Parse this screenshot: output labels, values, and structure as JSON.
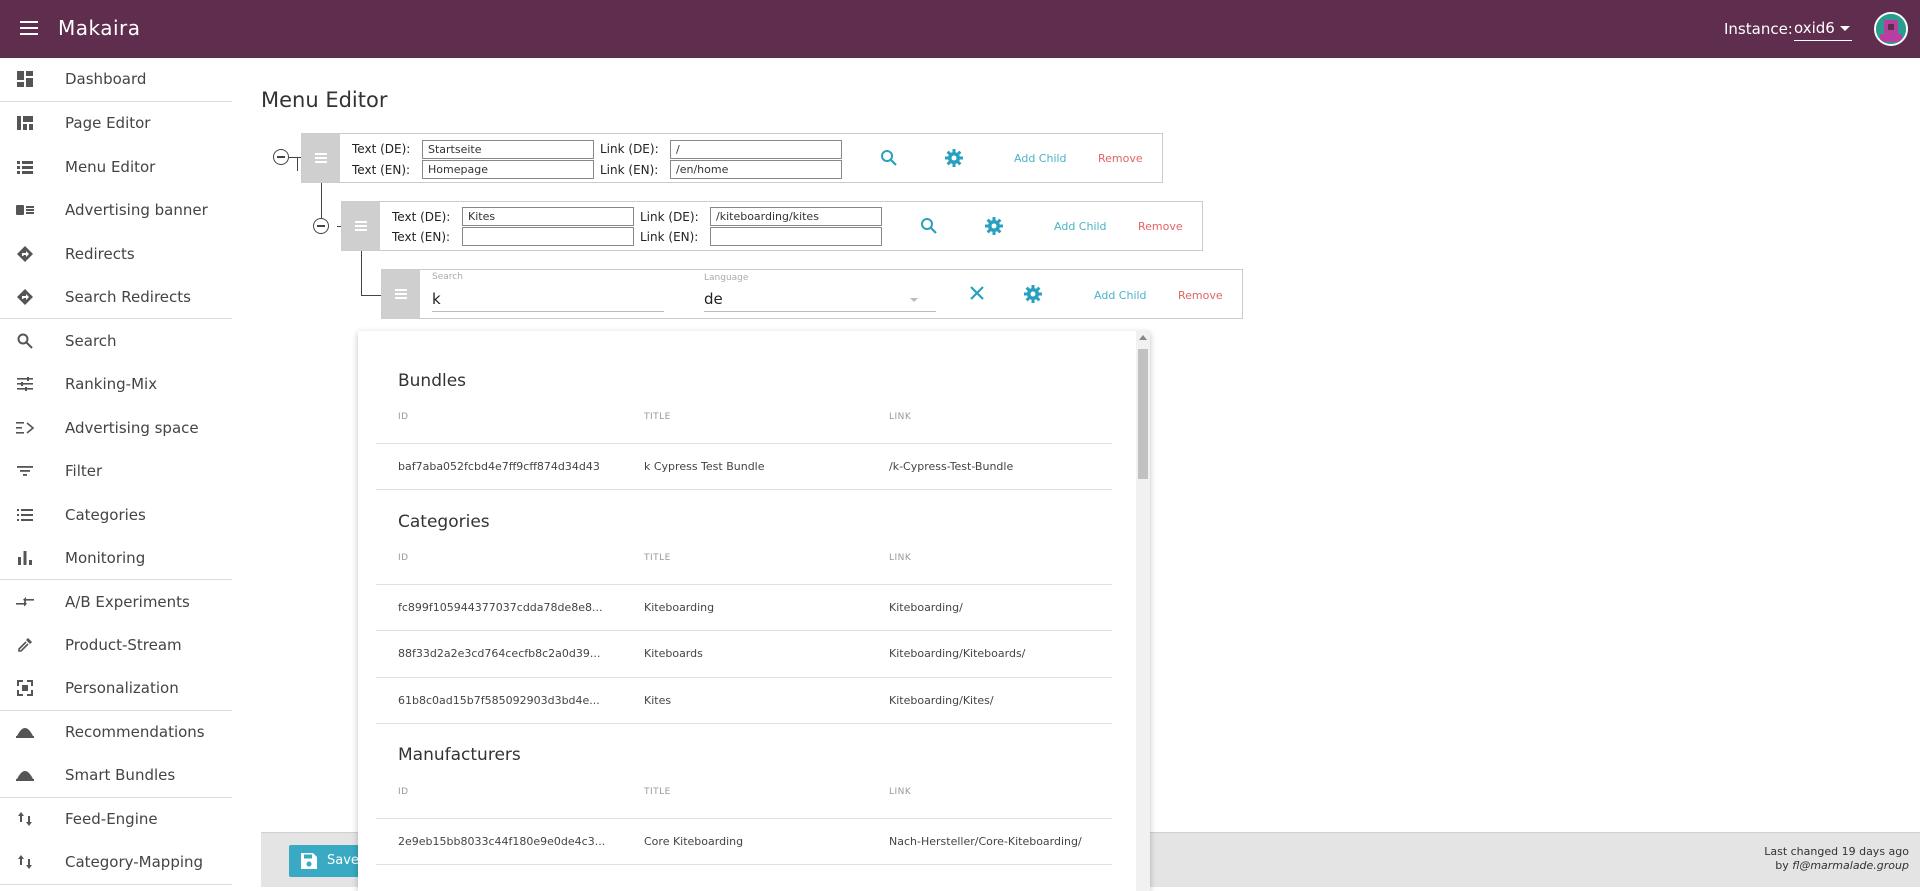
{
  "app": {
    "title": "Makaira"
  },
  "topbar": {
    "instance_label": "Instance:",
    "instance_value": "oxid6"
  },
  "sidebar": {
    "items": [
      {
        "label": "Dashboard",
        "icon": "dashboard-icon"
      },
      {
        "label": "Page Editor",
        "icon": "page-editor-icon"
      },
      {
        "label": "Menu Editor",
        "icon": "list-icon"
      },
      {
        "label": "Advertising banner",
        "icon": "banner-icon"
      },
      {
        "label": "Redirects",
        "icon": "directions-icon"
      },
      {
        "label": "Search Redirects",
        "icon": "directions-icon"
      },
      {
        "label": "Search",
        "icon": "search-icon"
      },
      {
        "label": "Ranking-Mix",
        "icon": "tune-icon"
      },
      {
        "label": "Advertising space",
        "icon": "advertising-space-icon"
      },
      {
        "label": "Filter",
        "icon": "filter-icon"
      },
      {
        "label": "Categories",
        "icon": "list-icon"
      },
      {
        "label": "Monitoring",
        "icon": "bar-chart-icon"
      },
      {
        "label": "A/B Experiments",
        "icon": "compare-arrows-icon"
      },
      {
        "label": "Product-Stream",
        "icon": "colorize-icon"
      },
      {
        "label": "Personalization",
        "icon": "personalization-icon"
      },
      {
        "label": "Recommendations",
        "icon": "dome-icon"
      },
      {
        "label": "Smart Bundles",
        "icon": "dome-icon"
      },
      {
        "label": "Feed-Engine",
        "icon": "swap-vert-icon"
      },
      {
        "label": "Category-Mapping",
        "icon": "swap-vert-icon"
      }
    ]
  },
  "main": {
    "title": "Menu Editor",
    "labels": {
      "text_de": "Text (DE):",
      "text_en": "Text (EN):",
      "link_de": "Link (DE):",
      "link_en": "Link (EN):",
      "add_child": "Add Child",
      "remove": "Remove",
      "search": "Search",
      "language": "Language"
    },
    "nodes": [
      {
        "text_de": "Startseite",
        "text_en": "Homepage",
        "link_de": "/",
        "link_en": "/en/home"
      },
      {
        "text_de": "Kites",
        "text_en": "",
        "link_de": "/kiteboarding/kites",
        "link_en": ""
      }
    ],
    "search_node": {
      "search_value": "k",
      "language_value": "de"
    }
  },
  "results": {
    "columns": {
      "id": "ID",
      "title": "TITLE",
      "link": "LINK"
    },
    "sections": [
      {
        "title": "Bundles",
        "rows": [
          {
            "id": "baf7aba052fcbd4e7ff9cff874d34d43",
            "title": "k Cypress Test Bundle",
            "link": "/k-Cypress-Test-Bundle"
          }
        ]
      },
      {
        "title": "Categories",
        "rows": [
          {
            "id": "fc899f105944377037cdda78de8e8...",
            "title": "Kiteboarding",
            "link": "Kiteboarding/"
          },
          {
            "id": "88f33d2a2e3cd764cecfb8c2a0d39...",
            "title": "Kiteboards",
            "link": "Kiteboarding/Kiteboards/"
          },
          {
            "id": "61b8c0ad15b7f585092903d3bd4e...",
            "title": "Kites",
            "link": "Kiteboarding/Kites/"
          }
        ]
      },
      {
        "title": "Manufacturers",
        "rows": [
          {
            "id": "2e9eb15bb8033c44f180e9e0de4c3...",
            "title": "Core Kiteboarding",
            "link": "Nach-Hersteller/Core-Kiteboarding/"
          }
        ]
      }
    ]
  },
  "footer": {
    "save_label": "Save",
    "last_changed": "Last changed 19 days ago",
    "by": "by",
    "author": "fl@marmalade.group"
  }
}
